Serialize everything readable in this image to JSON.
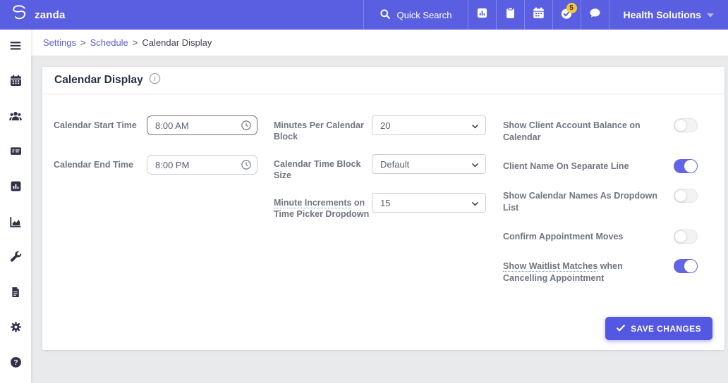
{
  "header": {
    "brand": "zanda",
    "quick_search_label": "Quick Search",
    "tasks_badge_count": "5",
    "account_label": "Health Solutions"
  },
  "breadcrumb": {
    "separator": ">",
    "settings": "Settings",
    "schedule": "Schedule",
    "current": "Calendar Display"
  },
  "panel": {
    "title": "Calendar Display",
    "form": {
      "col1": [
        {
          "label": "Calendar Start Time",
          "value": "8:00 AM"
        },
        {
          "label": "Calendar End Time",
          "value": "8:00 PM"
        }
      ],
      "col2": [
        {
          "label": "Minutes Per Calendar Block",
          "value": "20"
        },
        {
          "label": "Calendar Time Block Size",
          "value": "Default"
        },
        {
          "label_underlined": "Minute Increments",
          "label_rest": " on Time Picker Dropdown",
          "value": "15"
        }
      ],
      "toggles": [
        {
          "label": "Show Client Account Balance on Calendar",
          "state": "off"
        },
        {
          "label": "Client Name On Separate Line",
          "state": "on"
        },
        {
          "label": "Show Calendar Names As Dropdown List",
          "state": "off"
        },
        {
          "label": "Confirm Appointment Moves",
          "state": "off"
        },
        {
          "label_underlined": "Show Waitlist Matches",
          "label_rest": " when Cancelling Appointment",
          "state": "on"
        }
      ]
    },
    "save_button_label": "SAVE CHANGES"
  },
  "colors": {
    "accent": "#5a5ee0",
    "toggle_on": "#6165e6",
    "badge": "#f5c543",
    "sidebar_icon": "#2e3346",
    "page_background": "#e9eaec"
  }
}
